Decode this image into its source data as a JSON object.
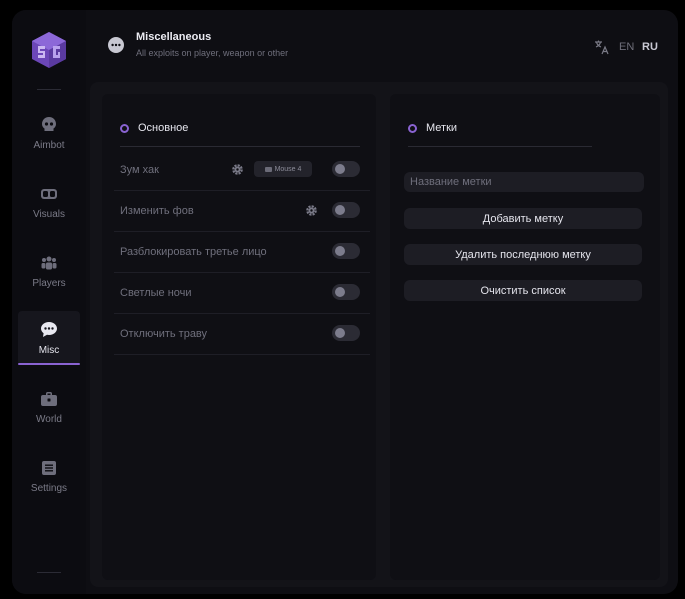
{
  "header": {
    "title": "Miscellaneous",
    "subtitle": "All exploits on player, weapon or other",
    "icon": "chat-bubble-icon",
    "languages": [
      "EN",
      "RU"
    ],
    "active_language": "RU"
  },
  "sidebar": {
    "items": [
      {
        "label": "Aimbot",
        "icon": "skull-icon"
      },
      {
        "label": "Visuals",
        "icon": "glasses-icon"
      },
      {
        "label": "Players",
        "icon": "users-icon"
      },
      {
        "label": "Misc",
        "icon": "chat-bubble-icon",
        "active": true
      },
      {
        "label": "World",
        "icon": "briefcase-icon"
      },
      {
        "label": "Settings",
        "icon": "list-icon"
      }
    ]
  },
  "left_panel": {
    "title": "Основное",
    "rows": [
      {
        "label": "Зум хак",
        "has_gear": true,
        "bind": "Mouse 4",
        "enabled": false
      },
      {
        "label": "Изменить фов",
        "has_gear": true,
        "enabled": false
      },
      {
        "label": "Разблокировать третье лицо",
        "enabled": false
      },
      {
        "label": "Светлые ночи",
        "enabled": false
      },
      {
        "label": "Отключить траву",
        "enabled": false
      }
    ]
  },
  "right_panel": {
    "title": "Метки",
    "input_placeholder": "Название метки",
    "input_value": "",
    "buttons": [
      "Добавить метку",
      "Удалить последнюю метку",
      "Очистить список"
    ]
  },
  "colors": {
    "accent": "#8a63d2",
    "background": "#0e0e13",
    "panel": "#0f0f14",
    "muted_text": "#6f6f7c"
  }
}
